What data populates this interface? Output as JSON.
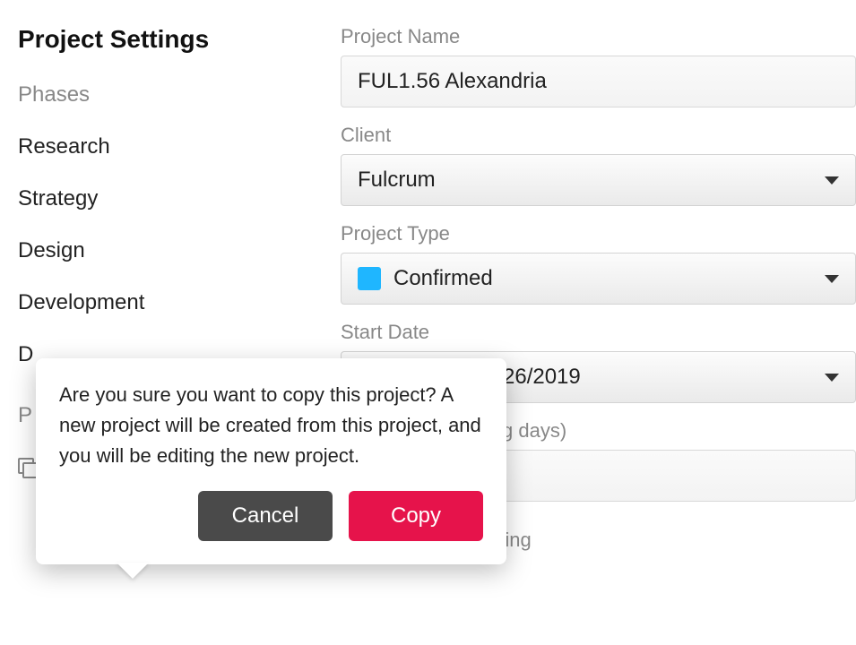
{
  "sidebar": {
    "title": "Project Settings",
    "phases_label": "Phases",
    "items": [
      "Research",
      "Strategy",
      "Design",
      "Development",
      "D"
    ],
    "partial_row": "P",
    "create_copy_label": "Create a Copy"
  },
  "form": {
    "project_name_label": "Project Name",
    "project_name_value": "FUL1.56 Alexandria",
    "client_label": "Client",
    "client_value": "Fulcrum",
    "project_type_label": "Project Type",
    "project_type_value": "Confirmed",
    "project_type_color": "#1fb6ff",
    "start_date_label": "Start Date",
    "start_date_value_partial": "26/2019",
    "days_label_partial": "g days)",
    "probability_label": "Probability of Winning"
  },
  "popover": {
    "message": "Are you sure you want to copy this project? A new project will be created from this project, and you will be editing the new project.",
    "cancel_label": "Cancel",
    "copy_label": "Copy"
  }
}
